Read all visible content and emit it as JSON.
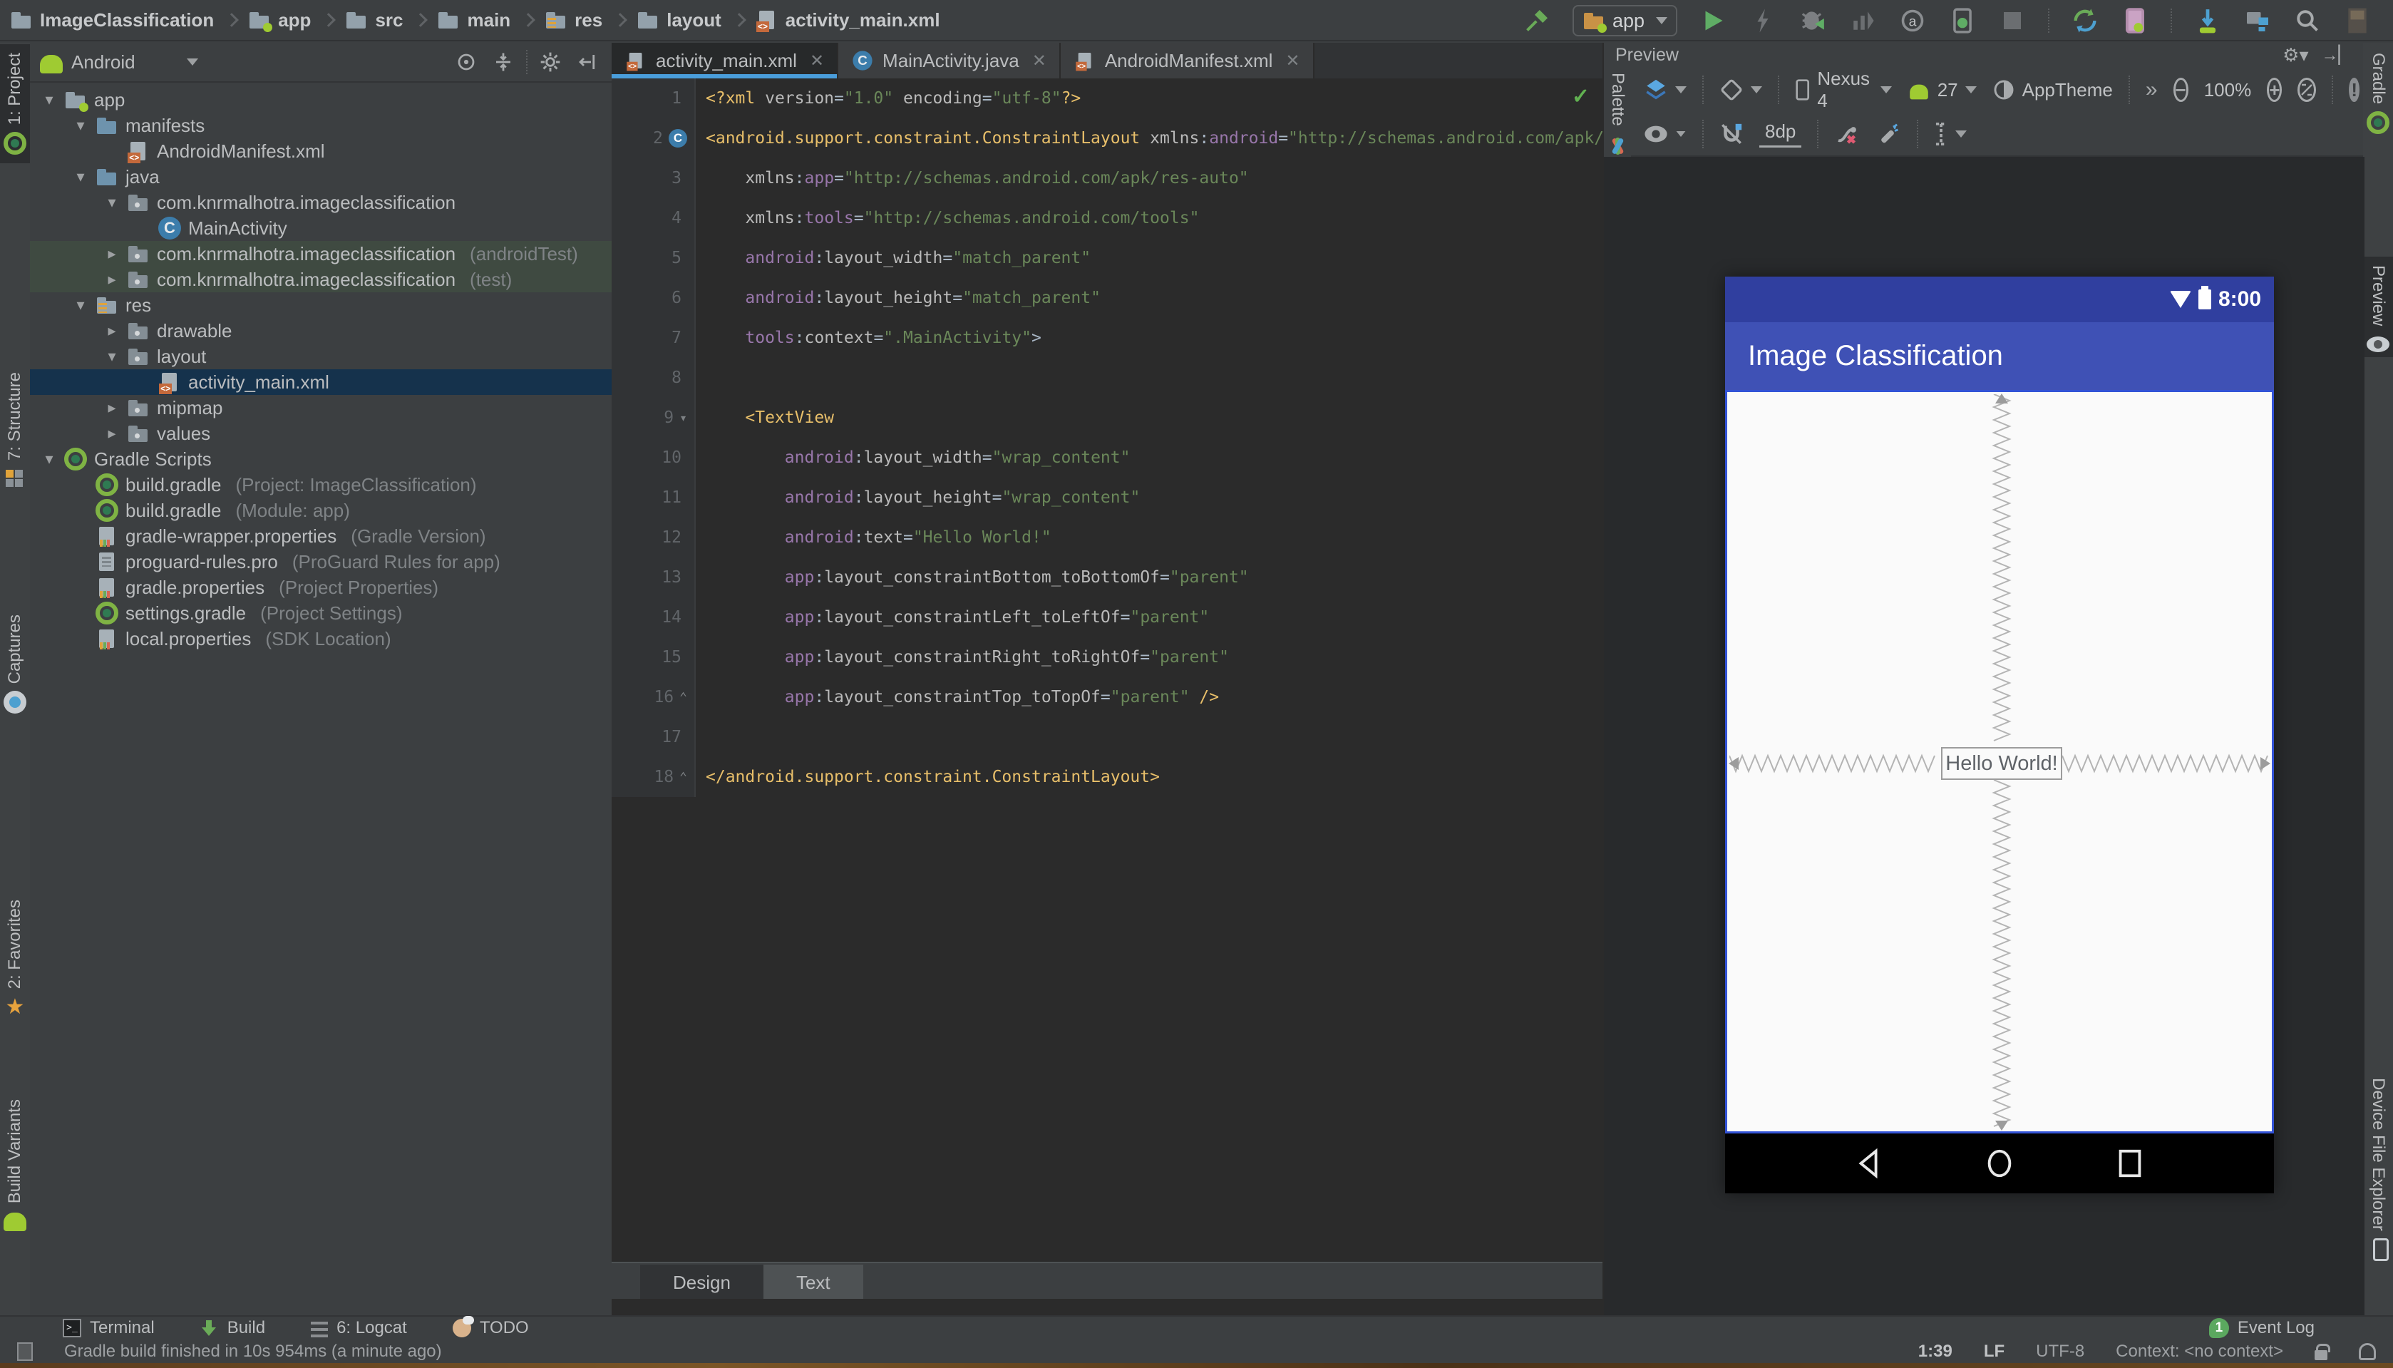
{
  "breadcrumbs": [
    {
      "label": "ImageClassification",
      "icon": "project-folder"
    },
    {
      "label": "app",
      "icon": "module-folder"
    },
    {
      "label": "src",
      "icon": "folder"
    },
    {
      "label": "main",
      "icon": "folder"
    },
    {
      "label": "res",
      "icon": "res-folder"
    },
    {
      "label": "layout",
      "icon": "folder"
    },
    {
      "label": "activity_main.xml",
      "icon": "xml-file"
    }
  ],
  "run_toolbar": {
    "config_label": "app"
  },
  "left_stripe": {
    "top": [
      {
        "label": "1: Project",
        "icon": "project-tab",
        "active": true
      },
      {
        "label": "7: Structure",
        "icon": "structure-tab",
        "active": false
      },
      {
        "label": "Captures",
        "icon": "captures-tab",
        "active": false
      }
    ],
    "bottom": [
      {
        "label": "2: Favorites",
        "icon": "favorites-star",
        "active": false
      },
      {
        "label": "Build Variants",
        "icon": "android-head",
        "active": false
      }
    ]
  },
  "right_stripe": {
    "top": [
      {
        "label": "Gradle",
        "icon": "gradle",
        "active": false
      },
      {
        "label": "Preview",
        "icon": "eye",
        "active": true
      }
    ],
    "bottom": [
      {
        "label": "Device File Explorer",
        "icon": "phone",
        "active": false
      }
    ]
  },
  "project_panel": {
    "view_selector": "Android",
    "tree": [
      {
        "label": "app",
        "icon": "folder-app",
        "arrow": "open",
        "level": 0
      },
      {
        "label": "manifests",
        "icon": "folder-blue",
        "arrow": "open",
        "level": 1
      },
      {
        "label": "AndroidManifest.xml",
        "icon": "file-manifest",
        "arrow": "none",
        "level": 2
      },
      {
        "label": "java",
        "icon": "folder-blue",
        "arrow": "open",
        "level": 1
      },
      {
        "label": "com.knrmalhotra.imageclassification",
        "icon": "folder-package",
        "arrow": "open",
        "level": 2
      },
      {
        "label": "MainActivity",
        "icon": "class-c",
        "arrow": "none",
        "level": 3
      },
      {
        "label": "com.knrmalhotra.imageclassification",
        "suffix": "(androidTest)",
        "icon": "folder-package",
        "arrow": "closed",
        "level": 2,
        "tinted": true
      },
      {
        "label": "com.knrmalhotra.imageclassification",
        "suffix": "(test)",
        "icon": "folder-package",
        "arrow": "closed",
        "level": 2,
        "tinted": true
      },
      {
        "label": "res",
        "icon": "folder-res",
        "arrow": "open",
        "level": 1
      },
      {
        "label": "drawable",
        "icon": "folder-package",
        "arrow": "closed",
        "level": 2
      },
      {
        "label": "layout",
        "icon": "folder-package",
        "arrow": "open",
        "level": 2
      },
      {
        "label": "activity_main.xml",
        "icon": "file-xml",
        "arrow": "none",
        "level": 3,
        "selected": true
      },
      {
        "label": "mipmap",
        "icon": "folder-package",
        "arrow": "closed",
        "level": 2
      },
      {
        "label": "values",
        "icon": "folder-package",
        "arrow": "closed",
        "level": 2
      },
      {
        "label": "Gradle Scripts",
        "icon": "gradle",
        "arrow": "open",
        "level": 0
      },
      {
        "label": "build.gradle",
        "suffix": "(Project: ImageClassification)",
        "icon": "gradle",
        "arrow": "none",
        "level": 1
      },
      {
        "label": "build.gradle",
        "suffix": "(Module: app)",
        "icon": "gradle",
        "arrow": "none",
        "level": 1
      },
      {
        "label": "gradle-wrapper.properties",
        "suffix": "(Gradle Version)",
        "icon": "file-props",
        "arrow": "none",
        "level": 1
      },
      {
        "label": "proguard-rules.pro",
        "suffix": "(ProGuard Rules for app)",
        "icon": "file-text",
        "arrow": "none",
        "level": 1
      },
      {
        "label": "gradle.properties",
        "suffix": "(Project Properties)",
        "icon": "file-props",
        "arrow": "none",
        "level": 1
      },
      {
        "label": "settings.gradle",
        "suffix": "(Project Settings)",
        "icon": "gradle",
        "arrow": "none",
        "level": 1
      },
      {
        "label": "local.properties",
        "suffix": "(SDK Location)",
        "icon": "file-props",
        "arrow": "none",
        "level": 1
      }
    ]
  },
  "editor": {
    "tabs": [
      {
        "label": "activity_main.xml",
        "icon": "file-xml",
        "active": true
      },
      {
        "label": "MainActivity.java",
        "icon": "class-c",
        "active": false
      },
      {
        "label": "AndroidManifest.xml",
        "icon": "file-manifest",
        "active": false
      }
    ],
    "design_text_tabs": [
      {
        "label": "Design",
        "active": false
      },
      {
        "label": "Text",
        "active": true
      }
    ],
    "lines": [
      {
        "n": 1,
        "indent": 0,
        "tokens": [
          [
            "tag",
            "<?xml "
          ],
          [
            "attr",
            "version"
          ],
          [
            "pl",
            "="
          ],
          [
            "val",
            "\"1.0\""
          ],
          [
            "pl",
            " "
          ],
          [
            "attr",
            "encoding"
          ],
          [
            "pl",
            "="
          ],
          [
            "val",
            "\"utf-8\""
          ],
          [
            "tag",
            "?>"
          ]
        ]
      },
      {
        "n": 2,
        "indent": 0,
        "badge": "C",
        "fold": "▾",
        "tokens": [
          [
            "tag",
            "<android.support.constraint.ConstraintLayout"
          ],
          [
            "pl",
            " "
          ],
          [
            "attr",
            "xmlns"
          ],
          [
            "pl",
            ":"
          ],
          [
            "ns",
            "android"
          ],
          [
            "pl",
            "="
          ],
          [
            "val",
            "\"http://schemas.android.com/apk/res/android\""
          ]
        ]
      },
      {
        "n": 3,
        "indent": 4,
        "tokens": [
          [
            "attr",
            "xmlns"
          ],
          [
            "pl",
            ":"
          ],
          [
            "ns",
            "app"
          ],
          [
            "pl",
            "="
          ],
          [
            "val",
            "\"http://schemas.android.com/apk/res-auto\""
          ]
        ]
      },
      {
        "n": 4,
        "indent": 4,
        "tokens": [
          [
            "attr",
            "xmlns"
          ],
          [
            "pl",
            ":"
          ],
          [
            "ns",
            "tools"
          ],
          [
            "pl",
            "="
          ],
          [
            "val",
            "\"http://schemas.android.com/tools\""
          ]
        ]
      },
      {
        "n": 5,
        "indent": 4,
        "tokens": [
          [
            "ns",
            "android"
          ],
          [
            "pl",
            ":"
          ],
          [
            "attr",
            "layout_width"
          ],
          [
            "pl",
            "="
          ],
          [
            "val",
            "\"match_parent\""
          ]
        ]
      },
      {
        "n": 6,
        "indent": 4,
        "tokens": [
          [
            "ns",
            "android"
          ],
          [
            "pl",
            ":"
          ],
          [
            "attr",
            "layout_height"
          ],
          [
            "pl",
            "="
          ],
          [
            "val",
            "\"match_parent\""
          ]
        ]
      },
      {
        "n": 7,
        "indent": 4,
        "tokens": [
          [
            "ns",
            "tools"
          ],
          [
            "pl",
            ":"
          ],
          [
            "attr",
            "context"
          ],
          [
            "pl",
            "="
          ],
          [
            "val",
            "\".MainActivity\""
          ],
          [
            "pl",
            ">"
          ]
        ]
      },
      {
        "n": 8,
        "indent": 0,
        "tokens": []
      },
      {
        "n": 9,
        "indent": 4,
        "fold": "▾",
        "tokens": [
          [
            "tag",
            "<TextView"
          ]
        ]
      },
      {
        "n": 10,
        "indent": 8,
        "tokens": [
          [
            "ns",
            "android"
          ],
          [
            "pl",
            ":"
          ],
          [
            "attr",
            "layout_width"
          ],
          [
            "pl",
            "="
          ],
          [
            "val",
            "\"wrap_content\""
          ]
        ]
      },
      {
        "n": 11,
        "indent": 8,
        "tokens": [
          [
            "ns",
            "android"
          ],
          [
            "pl",
            ":"
          ],
          [
            "attr",
            "layout_height"
          ],
          [
            "pl",
            "="
          ],
          [
            "val",
            "\"wrap_content\""
          ]
        ]
      },
      {
        "n": 12,
        "indent": 8,
        "tokens": [
          [
            "ns",
            "android"
          ],
          [
            "pl",
            ":"
          ],
          [
            "attr",
            "text"
          ],
          [
            "pl",
            "="
          ],
          [
            "val",
            "\"Hello World!\""
          ]
        ]
      },
      {
        "n": 13,
        "indent": 8,
        "tokens": [
          [
            "ns",
            "app"
          ],
          [
            "pl",
            ":"
          ],
          [
            "attr",
            "layout_constraintBottom_toBottomOf"
          ],
          [
            "pl",
            "="
          ],
          [
            "val",
            "\"parent\""
          ]
        ]
      },
      {
        "n": 14,
        "indent": 8,
        "tokens": [
          [
            "ns",
            "app"
          ],
          [
            "pl",
            ":"
          ],
          [
            "attr",
            "layout_constraintLeft_toLeftOf"
          ],
          [
            "pl",
            "="
          ],
          [
            "val",
            "\"parent\""
          ]
        ]
      },
      {
        "n": 15,
        "indent": 8,
        "tokens": [
          [
            "ns",
            "app"
          ],
          [
            "pl",
            ":"
          ],
          [
            "attr",
            "layout_constraintRight_toRightOf"
          ],
          [
            "pl",
            "="
          ],
          [
            "val",
            "\"parent\""
          ]
        ]
      },
      {
        "n": 16,
        "indent": 8,
        "fold": "⌃",
        "tokens": [
          [
            "ns",
            "app"
          ],
          [
            "pl",
            ":"
          ],
          [
            "attr",
            "layout_constraintTop_toTopOf"
          ],
          [
            "pl",
            "="
          ],
          [
            "val",
            "\"parent\""
          ],
          [
            "tag",
            " />"
          ]
        ]
      },
      {
        "n": 17,
        "indent": 0,
        "tokens": []
      },
      {
        "n": 18,
        "indent": 0,
        "fold": "⌃",
        "tokens": [
          [
            "tag",
            "</android.support.constraint.ConstraintLayout>"
          ]
        ]
      }
    ],
    "inspection_status": "✓"
  },
  "preview": {
    "title": "Preview",
    "device": "Nexus 4",
    "api_level": "27",
    "theme": "AppTheme",
    "zoom_level": "100%",
    "default_margin": "8dp",
    "overflow_chevron": "»",
    "palette_label": "Palette",
    "phone": {
      "status_time": "8:00",
      "app_title": "Image Classification",
      "hello_text": "Hello World!"
    }
  },
  "bottom_tool_bar": {
    "items": [
      {
        "label": "Terminal",
        "icon": "terminal"
      },
      {
        "label": "Build",
        "icon": "build"
      },
      {
        "label": "6: Logcat",
        "icon": "logcat"
      },
      {
        "label": "TODO",
        "icon": "todo"
      }
    ],
    "event_log_label": "Event Log",
    "event_log_count": "1"
  },
  "status_bar": {
    "message": "Gradle build finished in 10s 954ms (a minute ago)",
    "caret_position": "1:39",
    "line_separator": "LF",
    "encoding": "UTF-8",
    "context": "Context: <no context>"
  },
  "colors": {
    "phone_status_bar": "#303f9f",
    "phone_app_bar": "#3f51b5",
    "tab_underline": "#4a9edb",
    "event_log_badge": "#5ba85f",
    "selected_row": "#15324c",
    "editor_bg": "#2b2b2b",
    "panel_bg": "#3c3f41"
  }
}
